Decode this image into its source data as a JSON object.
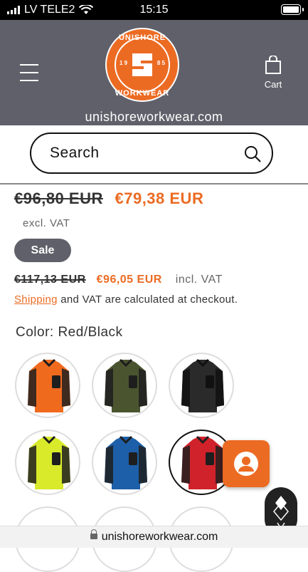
{
  "status_bar": {
    "carrier": "LV TELE2",
    "time": "15:15"
  },
  "header": {
    "logo": {
      "top_text": "UNISHORE",
      "bottom_text": "WORKWEAR",
      "year_left": "1 9",
      "year_right": "8 5"
    },
    "cart_label": "Cart",
    "domain": "unishoreworkwear.com"
  },
  "search": {
    "placeholder": "Search"
  },
  "pricing": {
    "old_price": "€96,80 EUR",
    "new_price": "€79,38 EUR",
    "excl_label": "excl. VAT",
    "sale_badge": "Sale",
    "old_price_incl": "€117,13 EUR",
    "new_price_incl": "€96,05 EUR",
    "incl_label": "incl. VAT",
    "shipping_link": "Shipping",
    "shipping_text": " and VAT are calculated at checkout."
  },
  "color": {
    "label": "Color: Red/Black",
    "swatches": [
      {
        "name": "Orange/Black",
        "main": "#f06a1e",
        "accent": "#1e1e1e"
      },
      {
        "name": "Green/Black",
        "main": "#4a5530",
        "accent": "#1e1e1e"
      },
      {
        "name": "Black",
        "main": "#2a2a2a",
        "accent": "#111111"
      },
      {
        "name": "Yellow/Black",
        "main": "#d8ea2a",
        "accent": "#1e1e1e"
      },
      {
        "name": "Blue/Black",
        "main": "#1d5fa8",
        "accent": "#1e1e1e"
      },
      {
        "name": "Red/Black",
        "main": "#d0222a",
        "accent": "#1e1e1e",
        "selected": true
      }
    ]
  },
  "url_bar": {
    "url": "unishoreworkwear.com"
  },
  "colors": {
    "accent": "#ec6b23",
    "header_bg": "#5f6069"
  }
}
